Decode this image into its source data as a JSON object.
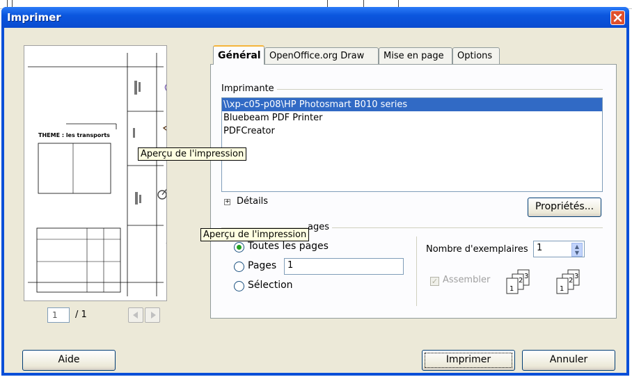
{
  "window": {
    "title": "Imprimer",
    "close_icon": "close-icon"
  },
  "preview": {
    "theme_text": "THEME : les transports",
    "tooltip": "Aperçu de l'impression",
    "page_current": "1",
    "page_total": "/ 1"
  },
  "tabs": [
    "Général",
    "OpenOffice.org Draw",
    "Mise en page",
    "Options"
  ],
  "printer": {
    "group_label": "Imprimante",
    "items": [
      "\\\\xp-c05-p08\\HP Photosmart B010 series",
      "Bluebeam PDF Printer",
      "PDFCreator"
    ],
    "selected_index": 0,
    "details_label": "Détails",
    "properties_label": "Propriétés..."
  },
  "range": {
    "group_label_partial": "ages",
    "tooltip": "Aperçu de l'impression",
    "all_pages_label": "Toutes les pages",
    "pages_label": "Pages",
    "pages_value": "1",
    "selection_label": "Sélection"
  },
  "copies": {
    "label": "Nombre d'exemplaires",
    "value": "1",
    "collate_label": "Assembler",
    "collate_checked": true
  },
  "buttons": {
    "help": "Aide",
    "print": "Imprimer",
    "cancel": "Annuler"
  },
  "colors": {
    "title_bar": "#0b56de",
    "selection": "#316ac5",
    "close": "#e0502c",
    "tooltip": "#ffffe1"
  }
}
